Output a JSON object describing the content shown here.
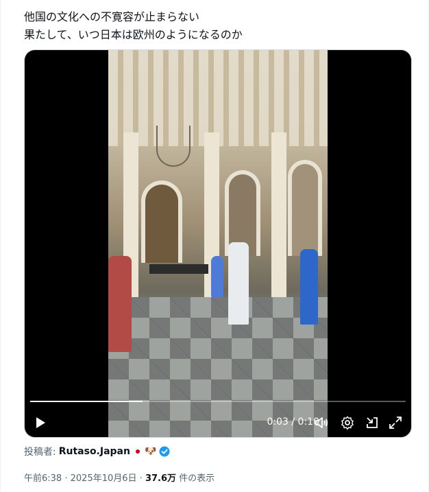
{
  "tweet": {
    "lines": [
      "他国の文化への不寛容が止まらない",
      "果たして、いつ日本は欧州のようになるのか"
    ]
  },
  "video": {
    "time_current": "0:03",
    "time_separator": "/",
    "time_total": "0:10",
    "progress_fraction": 0.3,
    "controls": [
      "play-icon",
      "volume-icon",
      "settings-icon",
      "minimize-icon",
      "fullscreen-icon"
    ]
  },
  "poster": {
    "label": "投稿者:",
    "name": "Rutaso.Japan",
    "flag": "japan-flag-icon",
    "emoji": "🐶",
    "verified_color": "#1d9bf0"
  },
  "meta": {
    "time": "午前6:38",
    "sep1": "·",
    "date": "2025年10月6日",
    "sep2": "·",
    "views": "37.6万",
    "views_suffix": "件の表示"
  }
}
